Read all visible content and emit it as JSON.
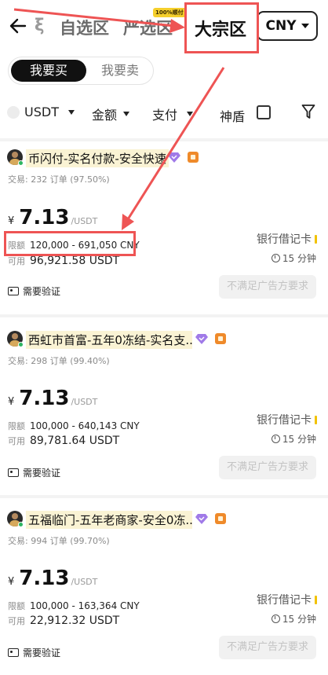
{
  "header": {
    "partial_tab": "ξ",
    "tabs": [
      {
        "label": "自选区"
      },
      {
        "label": "严选区",
        "badge": "100%顺付"
      },
      {
        "label": "大宗区"
      }
    ],
    "currency": "CNY"
  },
  "switch": {
    "buy": "我要买",
    "sell": "我要卖"
  },
  "filters": {
    "coin": "USDT",
    "amount": "金额",
    "payment": "支付",
    "shield": "神盾"
  },
  "ads": [
    {
      "merchant": "币闪付-实名付款-安全快速",
      "trades": "交易: 232 订单 (97.50%)",
      "currency_symbol": "¥",
      "price": "7.13",
      "price_unit": "/USDT",
      "limit_label": "限额",
      "limit": "120,000 - 691,050 CNY",
      "avail_label": "可用",
      "available": "96,921.58 USDT",
      "verify": "需要验证",
      "payment": "银行借记卡",
      "time": "15 分钟",
      "action": "不满足广告方要求"
    },
    {
      "merchant": "西虹市首富-五年0冻结-实名支...",
      "trades": "交易: 298 订单 (99.40%)",
      "currency_symbol": "¥",
      "price": "7.13",
      "price_unit": "/USDT",
      "limit_label": "限额",
      "limit": "100,000 - 640,143 CNY",
      "avail_label": "可用",
      "available": "89,781.64 USDT",
      "verify": "需要验证",
      "payment": "银行借记卡",
      "time": "15 分钟",
      "action": "不满足广告方要求"
    },
    {
      "merchant": "五福临门-五年老商家-安全0冻...",
      "trades": "交易: 994 订单 (99.70%)",
      "currency_symbol": "¥",
      "price": "7.13",
      "price_unit": "/USDT",
      "limit_label": "限额",
      "limit": "100,000 - 163,364 CNY",
      "avail_label": "可用",
      "available": "22,912.32 USDT",
      "verify": "需要验证",
      "payment": "银行借记卡",
      "time": "15 分钟",
      "action": "不满足广告方要求"
    }
  ],
  "colors": {
    "annotation": "#ee5454",
    "accent_badge": "#f5cf2c",
    "pay_bar": "#f2c200"
  }
}
